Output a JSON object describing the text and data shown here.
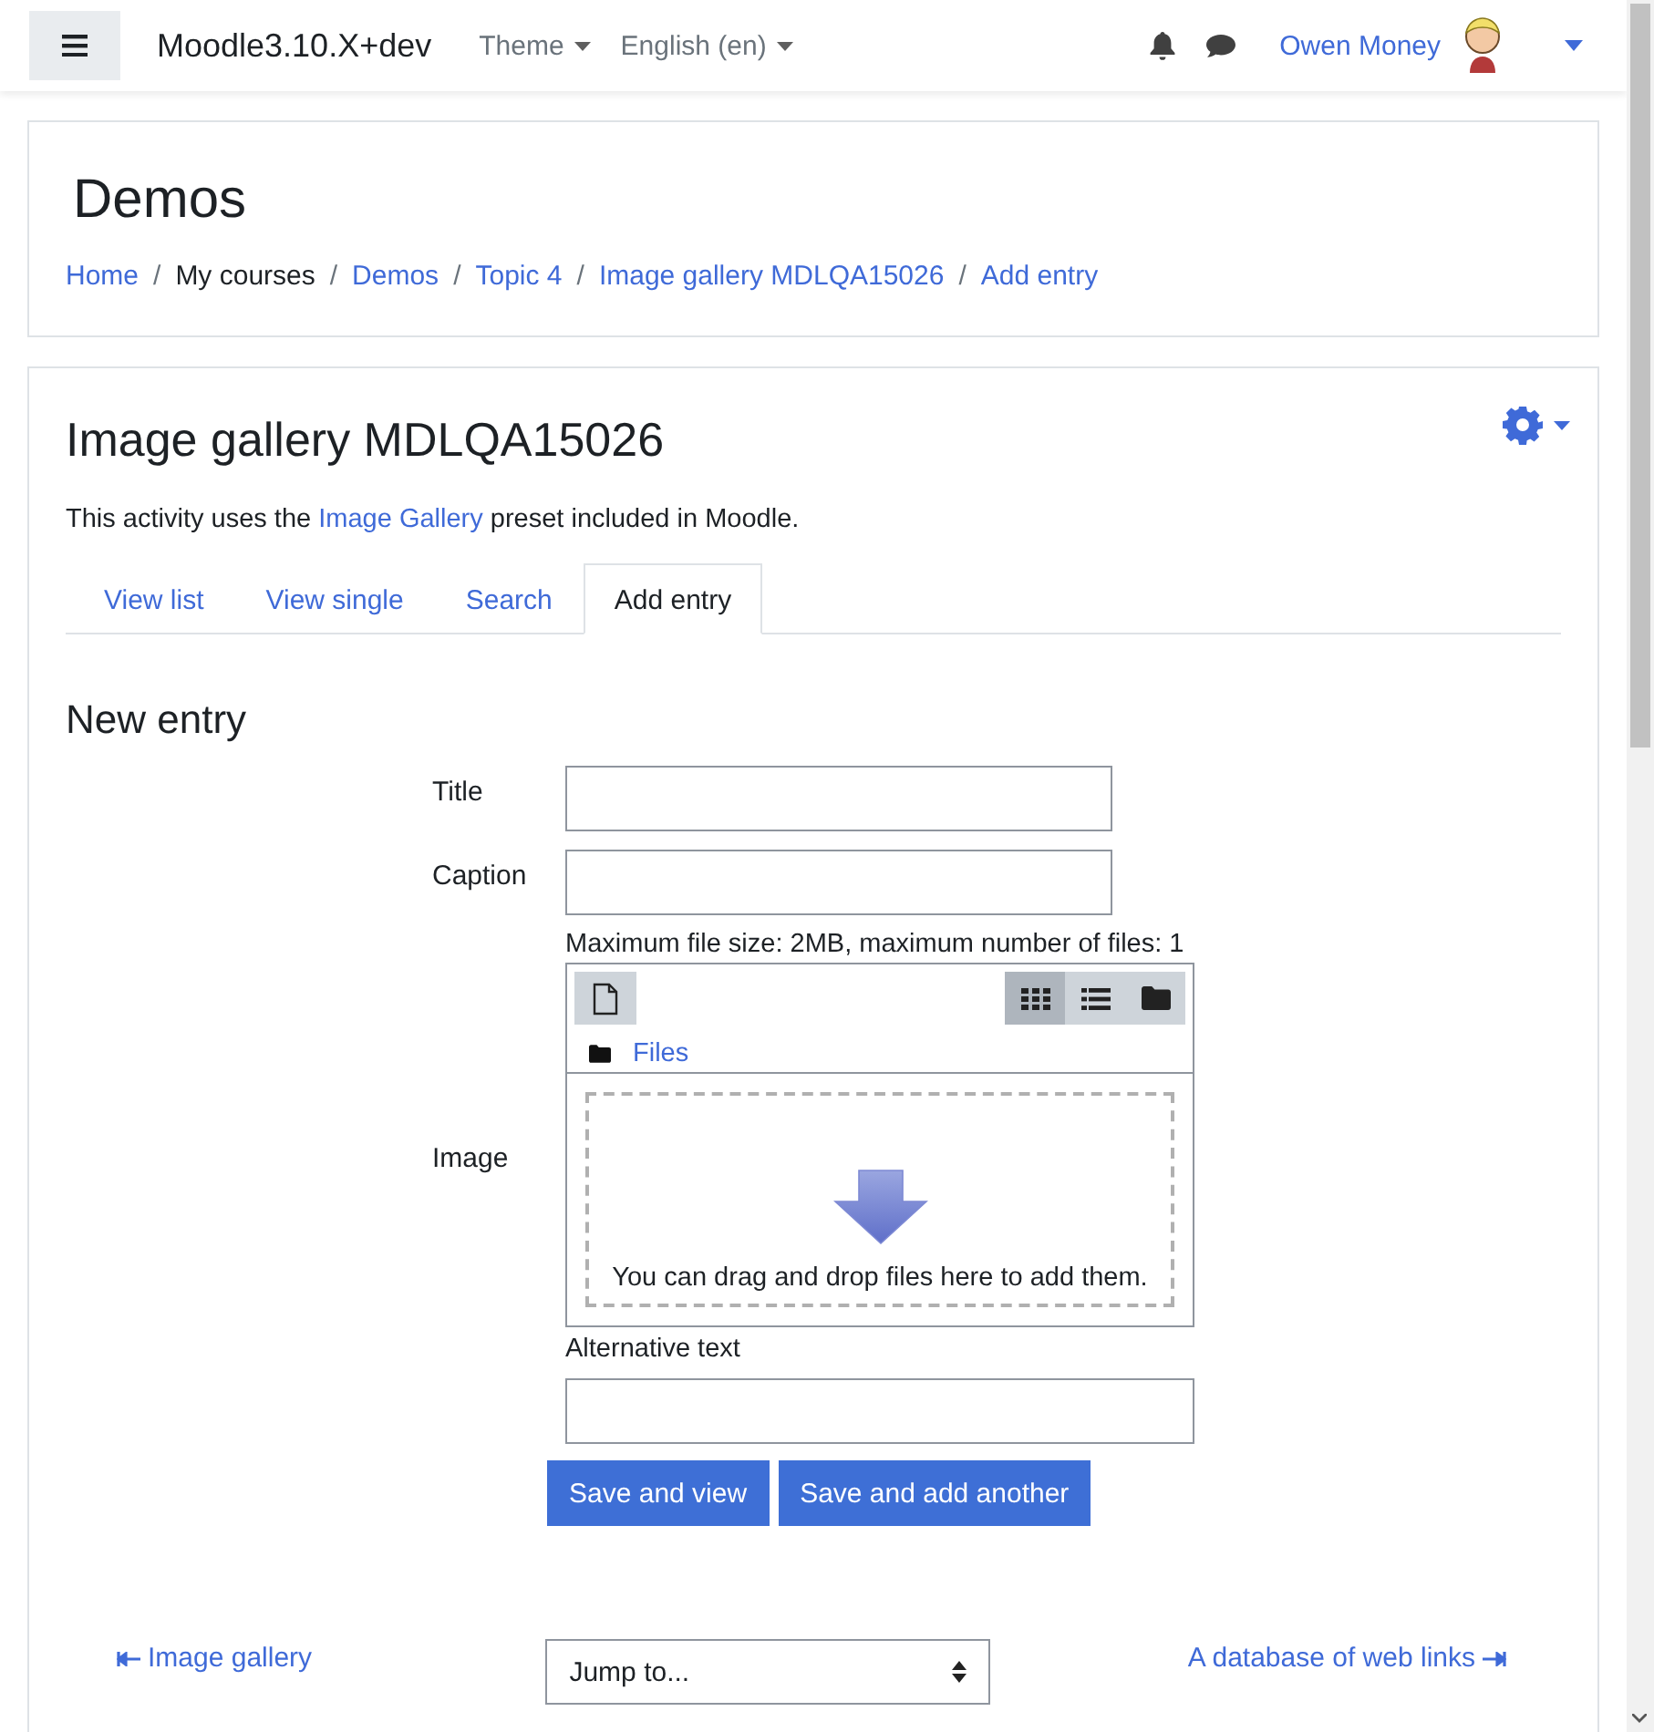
{
  "navbar": {
    "site_name": "Moodle3.10.X+dev",
    "menus": [
      {
        "label": "Theme"
      },
      {
        "label": "English (en)"
      }
    ],
    "user_name": "Owen Money"
  },
  "header": {
    "title": "Demos",
    "breadcrumbs": [
      {
        "label": "Home",
        "link": true
      },
      {
        "separator": "/",
        "label": "My courses",
        "link": false
      },
      {
        "separator": "/",
        "label": "Demos",
        "link": true
      },
      {
        "separator": "/",
        "label": "Topic 4",
        "link": true
      },
      {
        "separator": "/",
        "label": "Image gallery MDLQA15026",
        "link": true
      },
      {
        "separator": "/",
        "label": "Add entry",
        "link": true
      }
    ]
  },
  "activity": {
    "title": "Image gallery MDLQA15026",
    "intro": {
      "before": "This activity uses the ",
      "link": "Image Gallery",
      "after": " preset included in Moodle."
    },
    "tabs": [
      {
        "label": "View list",
        "selected": false
      },
      {
        "label": "View single",
        "selected": false
      },
      {
        "label": "Search",
        "selected": false
      },
      {
        "label": "Add entry",
        "selected": true
      }
    ]
  },
  "form": {
    "heading": "New entry",
    "fields": [
      {
        "kind": "text",
        "label": "Title"
      },
      {
        "kind": "text",
        "label": "Caption"
      },
      {
        "kind": "filepicker",
        "label": "Image",
        "limits": "Maximum file size: 2MB, maximum number of files: 1",
        "path": "Files",
        "drop_hint": "You can drag and drop files here to add them.",
        "views": [
          {
            "kind": "icons",
            "selected": true
          },
          {
            "kind": "list",
            "selected": false
          },
          {
            "kind": "tree",
            "selected": false
          }
        ]
      },
      {
        "kind": "stacked",
        "label": "Alternative text"
      }
    ],
    "buttons": [
      {
        "label": "Save and view"
      },
      {
        "label": "Save and add another"
      }
    ]
  },
  "footer_nav": {
    "previous": "Image gallery",
    "jump": "Jump to...",
    "next": "A database of web links"
  }
}
